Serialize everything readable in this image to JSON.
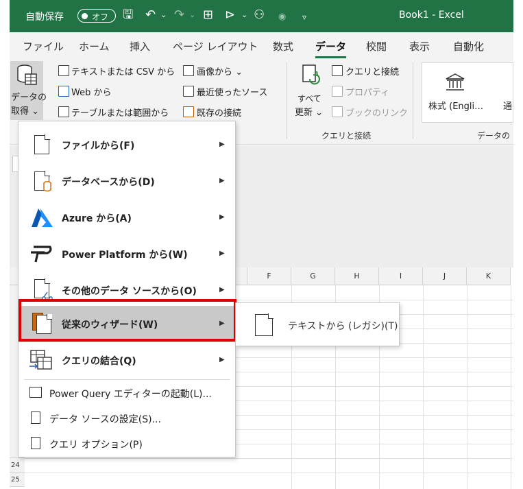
{
  "title_bar": {
    "autosave_label": "自動保存",
    "autosave_state": "オフ",
    "book_title": "Book1  -  Excel"
  },
  "ribbon_tabs": [
    "ファイル",
    "ホーム",
    "挿入",
    "ページ レイアウト",
    "数式",
    "データ",
    "校閲",
    "表示",
    "自動化"
  ],
  "active_tab": "データ",
  "ribbon": {
    "get_data_line1": "データの",
    "get_data_line2": "取得 ⌄",
    "from_text_csv": "テキストまたは CSV から",
    "from_web": "Web から",
    "from_table": "テーブルまたは範囲から",
    "from_picture": "画像から ⌄",
    "recent_sources": "最近使ったソース",
    "existing_connections": "既存の接続",
    "refresh_all_line1": "すべて",
    "refresh_all_line2": "更新 ⌄",
    "queries_connections": "クエリと接続",
    "properties": "プロパティ",
    "edit_links": "ブックのリンク",
    "queries_group_label": "クエリと接続",
    "stocks": "株式 (Engli…",
    "currency_partial": "通",
    "data_types_group_partial": "データの"
  },
  "columns": [
    "F",
    "G",
    "H",
    "I",
    "J",
    "K"
  ],
  "row_labels_visible": [
    "24",
    "25"
  ],
  "menu": {
    "items": [
      {
        "label": "ファイルから(F)",
        "has_submenu": true
      },
      {
        "label": "データベースから(D)",
        "has_submenu": true
      },
      {
        "label": "Azure から(A)",
        "has_submenu": true
      },
      {
        "label": "Power Platform から(W)",
        "has_submenu": true
      },
      {
        "label": "その他のデータ ソースから(O)",
        "has_submenu": true
      },
      {
        "label": "従来のウィザード(W)",
        "has_submenu": true,
        "highlighted": true
      },
      {
        "label": "クエリの結合(Q)",
        "has_submenu": true
      }
    ],
    "small_items": [
      {
        "label": "Power Query エディターの起動(L)..."
      },
      {
        "label": "データ ソースの設定(S)..."
      },
      {
        "label": "クエリ オプション(P)"
      }
    ]
  },
  "submenu": {
    "item_label": "テキストから (レガシ)(T)"
  },
  "colors": {
    "excel_green": "#217346",
    "highlight_red": "#e00000",
    "menu_highlight": "#c9c9c9"
  }
}
